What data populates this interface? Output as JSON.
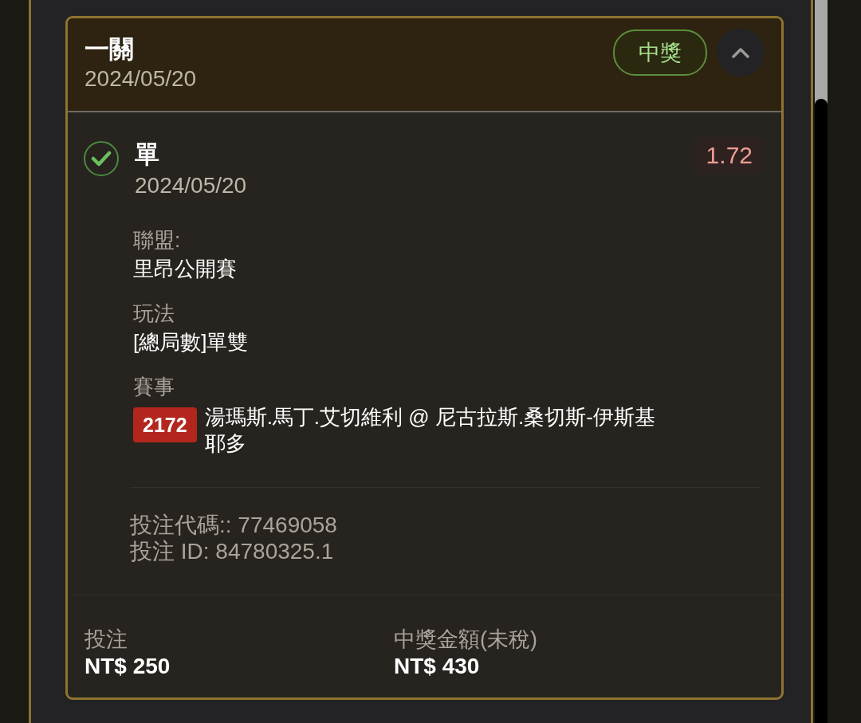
{
  "card": {
    "title": "一關",
    "date": "2024/05/20",
    "status": {
      "label": "中獎",
      "kind": "win"
    },
    "expanded": true
  },
  "selection": {
    "checked": true,
    "title": "單",
    "date": "2024/05/20",
    "odds": "1.72",
    "fields": [
      {
        "label": "聯盟:",
        "value": "里昂公開賽"
      },
      {
        "label": "玩法",
        "value": "[總局數]單雙"
      }
    ],
    "match": {
      "label": "賽事",
      "code": "2172",
      "name": "湯瑪斯.馬丁.艾切維利 @ 尼古拉斯.桑切斯-伊斯基耶多"
    },
    "bet_code": "投注代碼:: 77469058",
    "bet_id": "投注 ID: 84780325.1"
  },
  "summary": [
    {
      "label": "投注",
      "value": "NT$ 250"
    },
    {
      "label": "中獎金額(未稅)",
      "value": "NT$ 430"
    }
  ]
}
